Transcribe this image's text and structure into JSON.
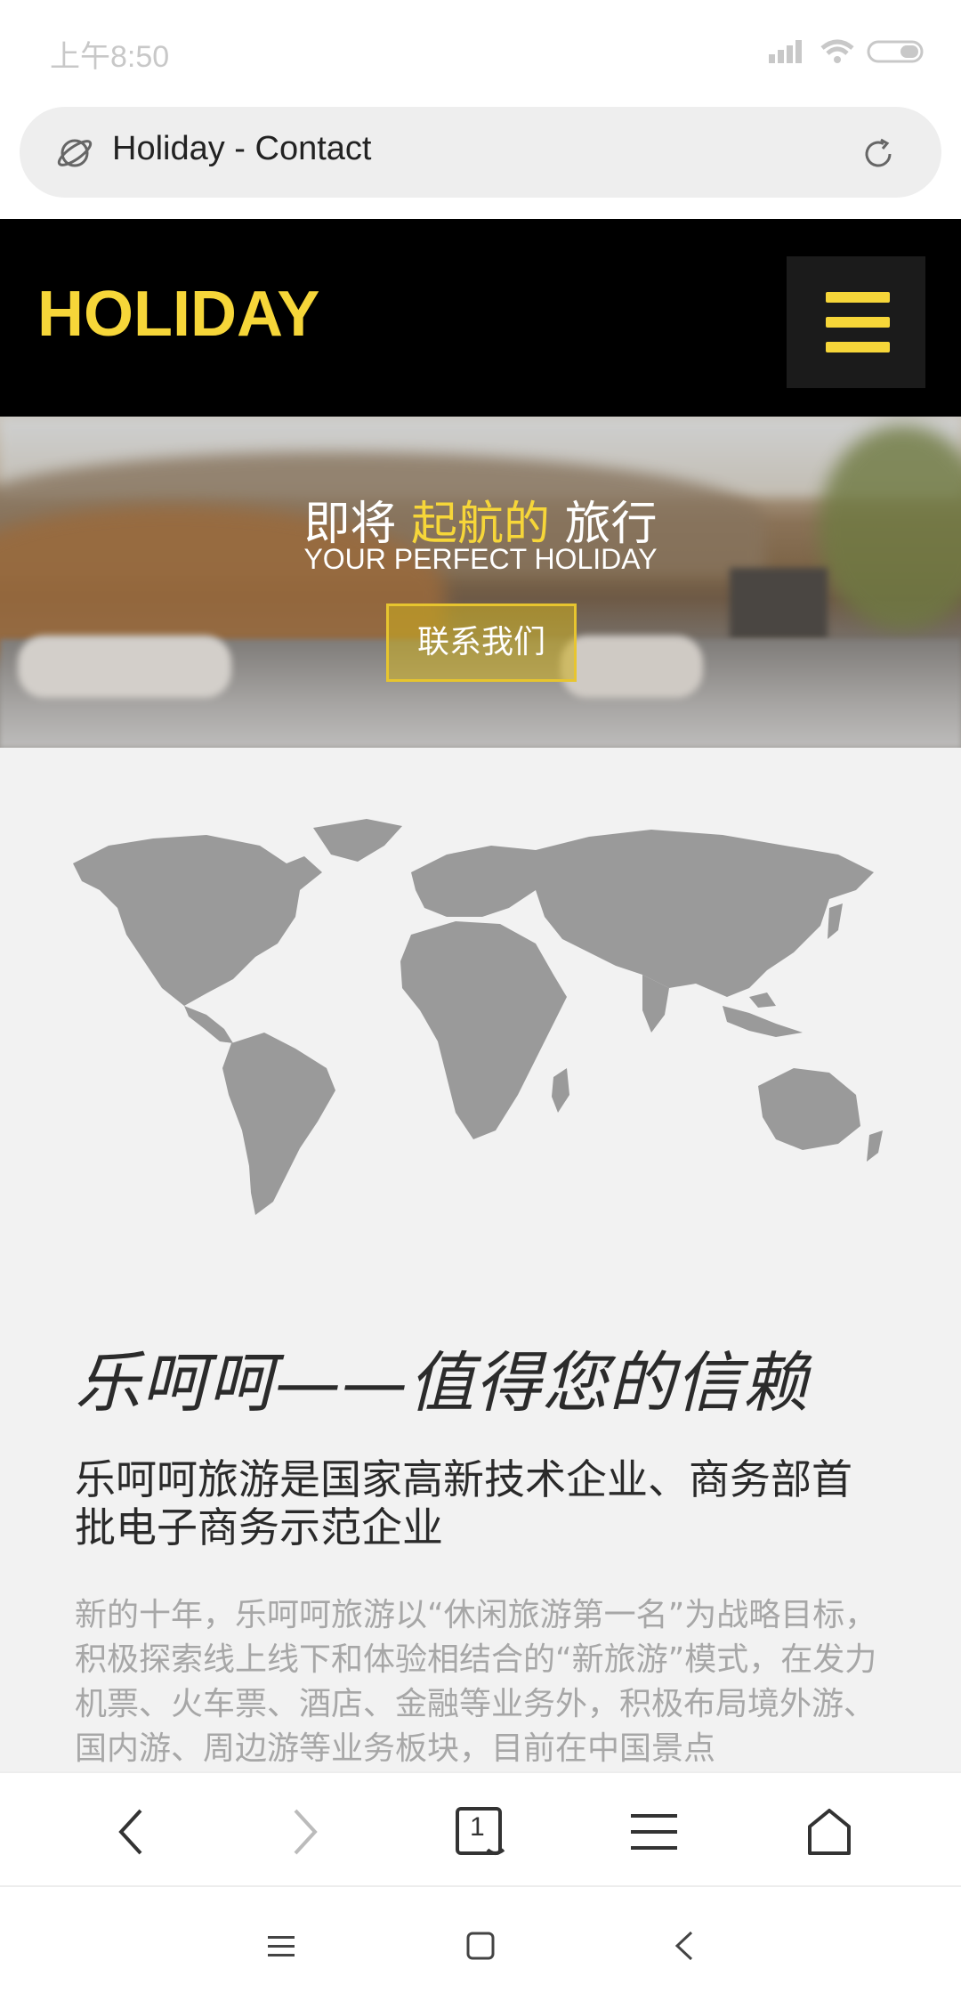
{
  "status_bar": {
    "time": "上午8:50",
    "icons": [
      "signal-icon",
      "wifi-icon",
      "battery-icon"
    ]
  },
  "address_bar": {
    "title": "Holiday - Contact",
    "icons": [
      "planet-icon",
      "reload-icon"
    ]
  },
  "site_header": {
    "logo": "HOLIDAY",
    "menu_icon": "hamburger-menu-icon",
    "accent_color": "#f6d639"
  },
  "hero": {
    "title_part1": "即将 ",
    "title_accent": "起航的",
    "title_part2": " 旅行",
    "subtitle": "YOUR PERFECT HOLIDAY",
    "button_label": "联系我们"
  },
  "content": {
    "map_icon": "world-map-icon",
    "heading": "乐呵呵——值得您的信赖",
    "subheading": "乐呵呵旅游是国家高新技术企业、商务部首批电子商务示范企业",
    "body": "新的十年，乐呵呵旅游以“休闲旅游第一名”为战略目标，积极探索线上线下和体验相结合的“新旅游”模式，在发力机票、火车票、酒店、金融等业务外，积极布局境外游、国内游、周边游等业务板块，目前在中国景点"
  },
  "browser_toolbar": {
    "tab_count": "1",
    "icons": [
      "back-icon",
      "forward-icon",
      "tabs-icon",
      "menu-icon",
      "home-icon"
    ]
  },
  "system_nav": {
    "icons": [
      "recents-icon",
      "home-square-icon",
      "back-triangle-icon"
    ]
  }
}
